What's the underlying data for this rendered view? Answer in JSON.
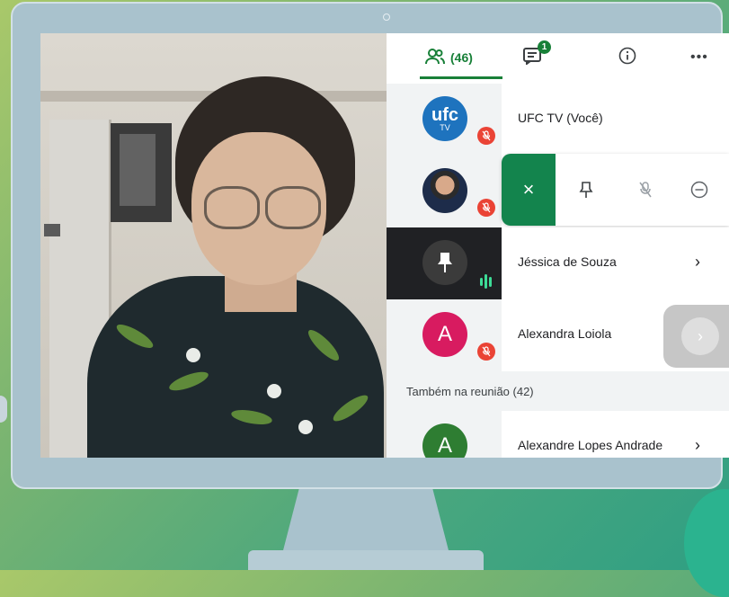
{
  "tabs": {
    "people_count": "(46)",
    "chat_badge": "1",
    "more": "•••"
  },
  "participants": [
    {
      "name": "UFC TV (Você)",
      "avatar_text": "ufc",
      "avatar_subtext": "TV",
      "muted": true
    },
    {
      "name": "",
      "muted": true
    },
    {
      "name": "Jéssica de Souza",
      "muted": false,
      "speaking": true
    },
    {
      "name": "Alexandra Loiola",
      "avatar_text": "A",
      "muted": true
    }
  ],
  "section": {
    "label": "Também na reunião (42)"
  },
  "more_participants": [
    {
      "name": "Alexandre Lopes Andrade",
      "avatar_text": "A"
    }
  ],
  "action_bar": {
    "close": "×"
  },
  "colors": {
    "accent": "#188038",
    "mute_red": "#ea4335",
    "avatar_pink": "#d81b60",
    "avatar_green": "#2e7d32",
    "ufc_blue": "#1e73be"
  }
}
